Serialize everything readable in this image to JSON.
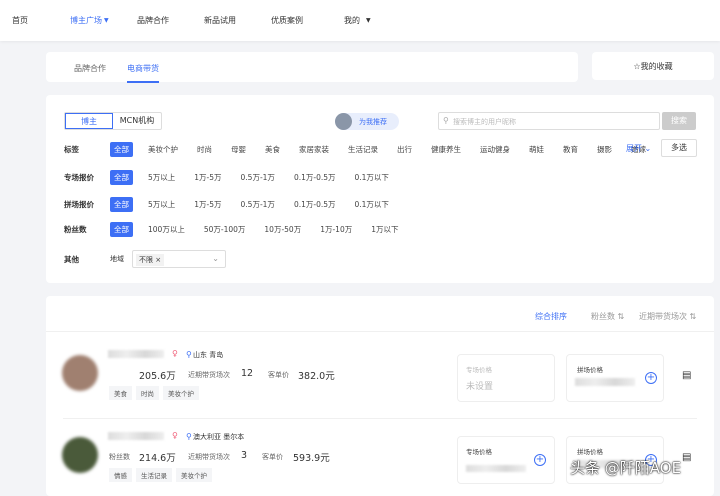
{
  "nav": {
    "items": [
      "首页",
      "博主广场",
      "品牌合作",
      "新品试用",
      "优质案例",
      "我的"
    ],
    "active": 1
  },
  "tabs": {
    "items": [
      "品牌合作",
      "电商带货"
    ],
    "active": 1
  },
  "favorites": {
    "label": "我的收藏",
    "icon": "star-icon"
  },
  "filter": {
    "type_toggle": [
      "博主",
      "MCN机构"
    ],
    "recommend": "为我推荐",
    "search_placeholder": "搜索博主的用户昵称",
    "search_button": "搜索",
    "tags": {
      "label": "标签",
      "options": [
        "全部",
        "美妆个护",
        "时尚",
        "母婴",
        "美食",
        "家居家装",
        "生活记录",
        "出行",
        "健康养生",
        "运动健身",
        "萌娃",
        "教育",
        "摄影",
        "婚嫁"
      ],
      "expand": "展开",
      "multi": "多选"
    },
    "special_price": {
      "label": "专场报价",
      "options": [
        "全部",
        "5万以上",
        "1万-5万",
        "0.5万-1万",
        "0.1万-0.5万",
        "0.1万以下"
      ]
    },
    "group_price": {
      "label": "拼场报价",
      "options": [
        "全部",
        "5万以上",
        "1万-5万",
        "0.5万-1万",
        "0.1万-0.5万",
        "0.1万以下"
      ]
    },
    "fans": {
      "label": "粉丝数",
      "options": [
        "全部",
        "100万以上",
        "50万-100万",
        "10万-50万",
        "1万-10万",
        "1万以下"
      ]
    },
    "other": {
      "label": "其他",
      "region_label": "地域",
      "region_value": "不限"
    }
  },
  "sort": {
    "items": [
      "综合排序",
      "粉丝数",
      "近期带货场次"
    ],
    "active": 0
  },
  "creators": [
    {
      "location": "山东 青岛",
      "fans_label": "",
      "fans": "205.6万",
      "sessions_label": "近期带货场次",
      "sessions": "12",
      "price_label": "客单价",
      "price": "382.0元",
      "tags": [
        "美食",
        "时尚",
        "美妆个护"
      ],
      "special_label": "专场价格",
      "special_value": "未设置",
      "group_label": "拼场价格",
      "gender_color": "#f0607a"
    },
    {
      "location": "澳大利亚 墨尔本",
      "fans_label": "粉丝数",
      "fans": "214.6万",
      "sessions_label": "近期带货场次",
      "sessions": "3",
      "price_label": "客单价",
      "price": "593.9元",
      "tags": [
        "情感",
        "生活记录",
        "美妆个护"
      ],
      "special_label": "专场价格",
      "group_label": "拼场价格",
      "gender_color": "#f0607a"
    }
  ],
  "watermark": "头条 @阡陌AOE",
  "accent": "#3d6ff5"
}
